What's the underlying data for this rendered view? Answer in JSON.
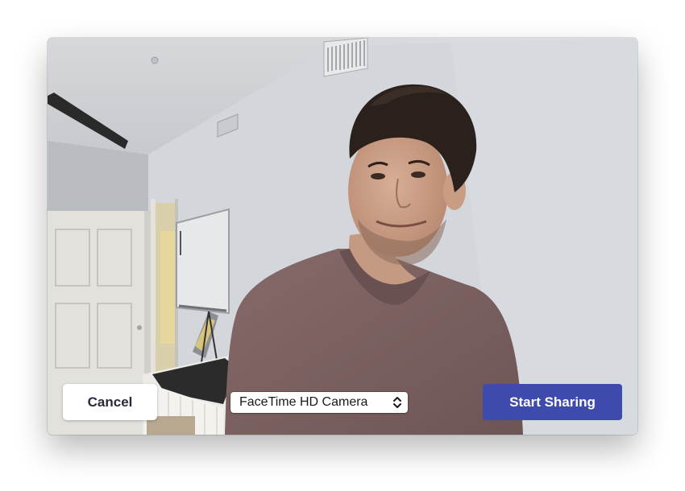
{
  "dialog": {
    "preview": {
      "description_icon": "camera-preview"
    },
    "cancel_label": "Cancel",
    "camera_select": {
      "selected": "FaceTime HD Camera"
    },
    "start_label": "Start Sharing",
    "colors": {
      "primary": "#3e4bac",
      "cancel_bg": "#ffffff",
      "wall": "#d2d6dc",
      "shirt": "#7a5f5f"
    }
  }
}
